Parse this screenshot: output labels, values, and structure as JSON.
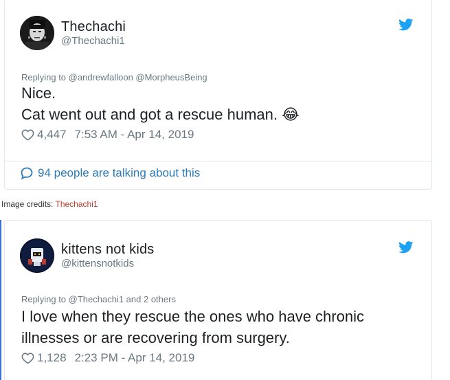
{
  "tweet1": {
    "display_name": "Thechachi",
    "handle": "@Thechachi1",
    "replying_prefix": "Replying to ",
    "replying_to": "@andrewfalloon @MorpheusBeing",
    "text_line1": "Nice.",
    "text_line2": "Cat went out and got a rescue human.",
    "emoji": "😂",
    "likes": "4,447",
    "timestamp": "7:53 AM - Apr 14, 2019",
    "talking": "94 people are talking about this",
    "avatar_icon": "avatar-frankenstein",
    "heart_icon": "heart-outline-icon",
    "twitter_icon": "twitter-bird-icon"
  },
  "credits": {
    "prefix": "Image credits: ",
    "source": "Thechachi1"
  },
  "tweet2": {
    "display_name": "kittens not kids",
    "handle": "@kittensnotkids",
    "replying_prefix": "Replying to ",
    "replying_to": "@Thechachi1 and 2 others",
    "text_line1": "I love when they rescue the ones who have chronic",
    "text_line2": "illnesses or are recovering from surgery.",
    "likes": "1,128",
    "timestamp": "2:23 PM - Apr 14, 2019",
    "avatar_icon": "avatar-robot",
    "heart_icon": "heart-outline-icon",
    "twitter_icon": "twitter-bird-icon"
  },
  "colors": {
    "twitter_blue": "#1da1f2",
    "link_blue": "#2b7bb9",
    "meta_gray": "#697882",
    "credit_red": "#c0392b",
    "border": "#e1e8ed"
  }
}
